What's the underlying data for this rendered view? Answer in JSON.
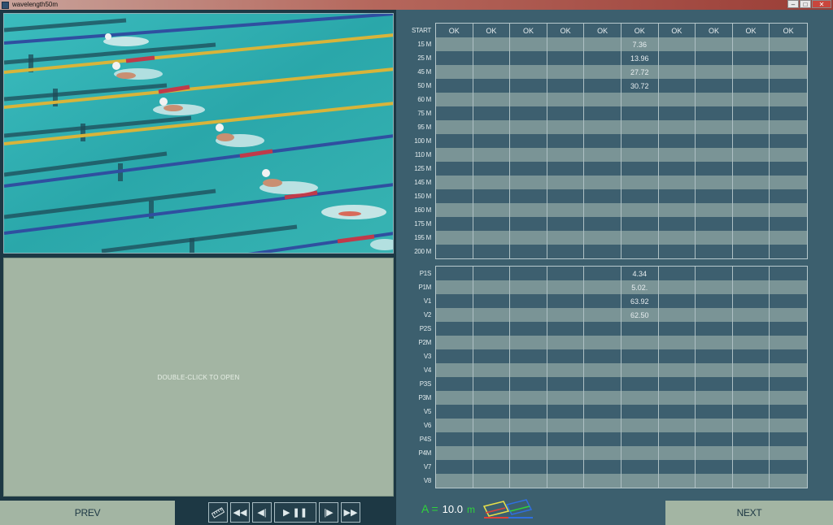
{
  "window": {
    "title": "wavelength50m",
    "controls": {
      "minimize": "–",
      "maximize": "□",
      "close": "✕"
    }
  },
  "video_panel": {
    "icon": "swimming-video-frame"
  },
  "open_panel": {
    "text": "DOUBLE-CLICK TO OPEN"
  },
  "nav": {
    "prev_label": "PREV",
    "next_label": "NEXT"
  },
  "playback_controls": [
    {
      "name": "ruler-button",
      "icon": "ruler-icon",
      "glyph": "▭"
    },
    {
      "name": "rewind-button",
      "icon": "rewind-icon",
      "glyph": "◀◀"
    },
    {
      "name": "step-back-button",
      "icon": "step-back-icon",
      "glyph": "◀|"
    },
    {
      "name": "play-pause-button",
      "icon": "play-pause-icon",
      "glyph": "▶ ❚❚"
    },
    {
      "name": "step-forward-button",
      "icon": "step-forward-icon",
      "glyph": "|▶"
    },
    {
      "name": "fast-forward-button",
      "icon": "fast-forward-icon",
      "glyph": "▶▶"
    }
  ],
  "a_field": {
    "label": "A =",
    "value": "10.0",
    "unit": "m"
  },
  "colors": {
    "accent_green": "#2fd33a",
    "panel_green": "#a3b5a3",
    "bg_blue": "#3c5f6e",
    "dark_bg": "#1d3844"
  },
  "split_table": {
    "header_label": "START",
    "columns": [
      "OK",
      "OK",
      "OK",
      "OK",
      "OK",
      "OK",
      "OK",
      "OK",
      "OK",
      "OK"
    ],
    "rows": [
      {
        "label": "15 M",
        "cells": [
          "",
          "",
          "",
          "",
          "",
          "7.36",
          "",
          "",
          "",
          ""
        ]
      },
      {
        "label": "25 M",
        "cells": [
          "",
          "",
          "",
          "",
          "",
          "13.96",
          "",
          "",
          "",
          ""
        ]
      },
      {
        "label": "45 M",
        "cells": [
          "",
          "",
          "",
          "",
          "",
          "27.72",
          "",
          "",
          "",
          ""
        ]
      },
      {
        "label": "50 M",
        "cells": [
          "",
          "",
          "",
          "",
          "",
          "30.72",
          "",
          "",
          "",
          ""
        ]
      },
      {
        "label": "60 M",
        "cells": [
          "",
          "",
          "",
          "",
          "",
          "",
          "",
          "",
          "",
          ""
        ]
      },
      {
        "label": "75 M",
        "cells": [
          "",
          "",
          "",
          "",
          "",
          "",
          "",
          "",
          "",
          ""
        ]
      },
      {
        "label": "95 M",
        "cells": [
          "",
          "",
          "",
          "",
          "",
          "",
          "",
          "",
          "",
          ""
        ]
      },
      {
        "label": "100 M",
        "cells": [
          "",
          "",
          "",
          "",
          "",
          "",
          "",
          "",
          "",
          ""
        ]
      },
      {
        "label": "110 M",
        "cells": [
          "",
          "",
          "",
          "",
          "",
          "",
          "",
          "",
          "",
          ""
        ]
      },
      {
        "label": "125 M",
        "cells": [
          "",
          "",
          "",
          "",
          "",
          "",
          "",
          "",
          "",
          ""
        ]
      },
      {
        "label": "145 M",
        "cells": [
          "",
          "",
          "",
          "",
          "",
          "",
          "",
          "",
          "",
          ""
        ]
      },
      {
        "label": "150 M",
        "cells": [
          "",
          "",
          "",
          "",
          "",
          "",
          "",
          "",
          "",
          ""
        ]
      },
      {
        "label": "160 M",
        "cells": [
          "",
          "",
          "",
          "",
          "",
          "",
          "",
          "",
          "",
          ""
        ]
      },
      {
        "label": "175 M",
        "cells": [
          "",
          "",
          "",
          "",
          "",
          "",
          "",
          "",
          "",
          ""
        ]
      },
      {
        "label": "195 M",
        "cells": [
          "",
          "",
          "",
          "",
          "",
          "",
          "",
          "",
          "",
          ""
        ]
      },
      {
        "label": "200 M",
        "cells": [
          "",
          "",
          "",
          "",
          "",
          "",
          "",
          "",
          "",
          ""
        ]
      }
    ]
  },
  "stroke_table": {
    "rows": [
      {
        "label": "P1S",
        "cells": [
          "",
          "",
          "",
          "",
          "",
          "4.34",
          "",
          "",
          "",
          ""
        ]
      },
      {
        "label": "P1M",
        "cells": [
          "",
          "",
          "",
          "",
          "",
          "5.02.",
          "",
          "",
          "",
          ""
        ]
      },
      {
        "label": "V1",
        "cells": [
          "",
          "",
          "",
          "",
          "",
          "63.92",
          "",
          "",
          "",
          ""
        ]
      },
      {
        "label": "V2",
        "cells": [
          "",
          "",
          "",
          "",
          "",
          "62.50",
          "",
          "",
          "",
          ""
        ]
      },
      {
        "label": "P2S",
        "cells": [
          "",
          "",
          "",
          "",
          "",
          "",
          "",
          "",
          "",
          ""
        ]
      },
      {
        "label": "P2M",
        "cells": [
          "",
          "",
          "",
          "",
          "",
          "",
          "",
          "",
          "",
          ""
        ]
      },
      {
        "label": "V3",
        "cells": [
          "",
          "",
          "",
          "",
          "",
          "",
          "",
          "",
          "",
          ""
        ]
      },
      {
        "label": "V4",
        "cells": [
          "",
          "",
          "",
          "",
          "",
          "",
          "",
          "",
          "",
          ""
        ]
      },
      {
        "label": "P3S",
        "cells": [
          "",
          "",
          "",
          "",
          "",
          "",
          "",
          "",
          "",
          ""
        ]
      },
      {
        "label": "P3M",
        "cells": [
          "",
          "",
          "",
          "",
          "",
          "",
          "",
          "",
          "",
          ""
        ]
      },
      {
        "label": "V5",
        "cells": [
          "",
          "",
          "",
          "",
          "",
          "",
          "",
          "",
          "",
          ""
        ]
      },
      {
        "label": "V6",
        "cells": [
          "",
          "",
          "",
          "",
          "",
          "",
          "",
          "",
          "",
          ""
        ]
      },
      {
        "label": "P4S",
        "cells": [
          "",
          "",
          "",
          "",
          "",
          "",
          "",
          "",
          "",
          ""
        ]
      },
      {
        "label": "P4M",
        "cells": [
          "",
          "",
          "",
          "",
          "",
          "",
          "",
          "",
          "",
          ""
        ]
      },
      {
        "label": "V7",
        "cells": [
          "",
          "",
          "",
          "",
          "",
          "",
          "",
          "",
          "",
          ""
        ]
      },
      {
        "label": "V8",
        "cells": [
          "",
          "",
          "",
          "",
          "",
          "",
          "",
          "",
          "",
          ""
        ]
      }
    ]
  }
}
